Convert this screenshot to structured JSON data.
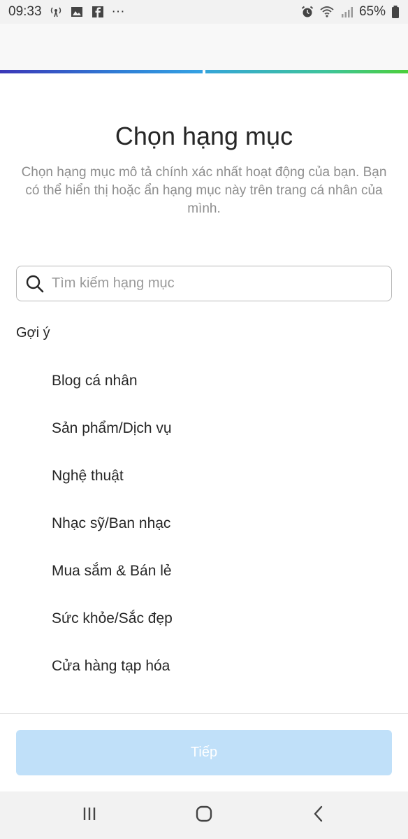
{
  "status_bar": {
    "time": "09:33",
    "more": "···",
    "battery": "65%",
    "icons_left": [
      "radio-icon",
      "image-icon",
      "facebook-icon"
    ],
    "icons_right": [
      "alarm-icon",
      "wifi-icon",
      "signal-icon"
    ]
  },
  "page": {
    "title": "Chọn hạng mục",
    "subtitle": "Chọn hạng mục mô tả chính xác nhất hoạt động của bạn. Bạn có thể hiển thị hoặc ẩn hạng mục này trên trang cá nhân của mình."
  },
  "search": {
    "placeholder": "Tìm kiếm hạng mục",
    "value": ""
  },
  "suggestions": {
    "label": "Gợi ý",
    "items": [
      {
        "label": "Blog cá nhân"
      },
      {
        "label": "Sản phẩm/Dịch vụ"
      },
      {
        "label": "Nghệ thuật"
      },
      {
        "label": "Nhạc sỹ/Ban nhạc"
      },
      {
        "label": "Mua sắm & Bán lẻ"
      },
      {
        "label": "Sức khỏe/Sắc đẹp"
      },
      {
        "label": "Cửa hàng tạp hóa"
      }
    ]
  },
  "footer": {
    "next_label": "Tiếp"
  },
  "progress": {
    "steps_total": 2,
    "steps_completed": 2
  },
  "colors": {
    "button_disabled": "#c0e0f9",
    "progress_start": "#3b37b8",
    "progress_end": "#4ccf3a"
  },
  "nav": {
    "icons": [
      "recent-apps-icon",
      "home-icon",
      "back-icon"
    ]
  }
}
